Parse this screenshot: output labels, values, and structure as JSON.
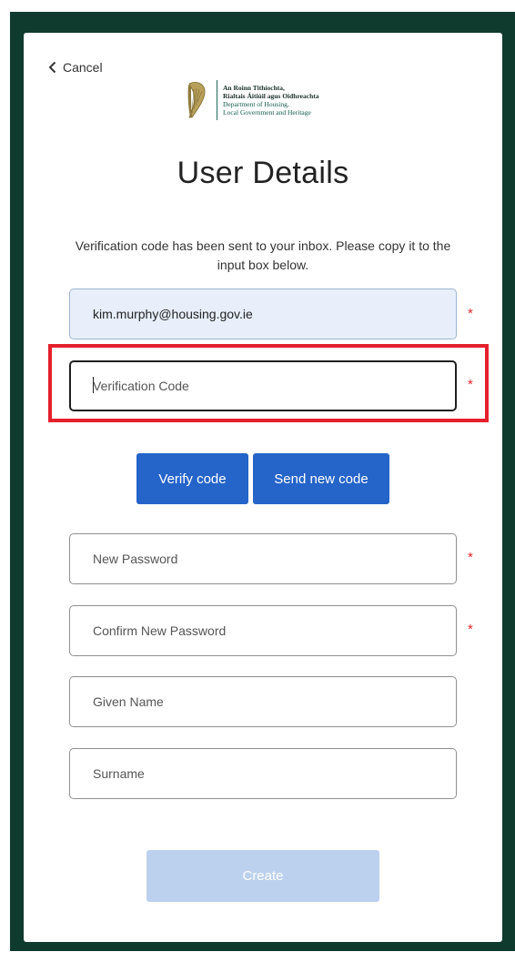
{
  "header": {
    "cancel_label": "Cancel",
    "logo": {
      "line1": "An Roinn Tithíochta,",
      "line2": "Rialtais Áitiúil agus Oidhreachta",
      "line3": "Department of Housing,",
      "line4": "Local Government and Heritage"
    }
  },
  "page": {
    "title": "User Details",
    "intro": "Verification code has been sent to your inbox. Please copy it to the input box below."
  },
  "form": {
    "email_value": "kim.murphy@housing.gov.ie",
    "verification_placeholder": "Verification Code",
    "new_password_placeholder": "New Password",
    "confirm_password_placeholder": "Confirm New Password",
    "given_name_placeholder": "Given Name",
    "surname_placeholder": "Surname",
    "required_marker": "*"
  },
  "buttons": {
    "verify_code": "Verify code",
    "send_new_code": "Send new code",
    "create": "Create"
  },
  "colors": {
    "page_frame": "#0f3a2e",
    "primary_button": "#2564c9",
    "disabled_button": "#bcd1ed",
    "required_marker": "#e0262b",
    "highlight_box": "#e4202b",
    "email_field_bg": "#e8effb"
  },
  "icons": {
    "cancel": "chevron-left-icon",
    "logo": "harp-icon"
  }
}
